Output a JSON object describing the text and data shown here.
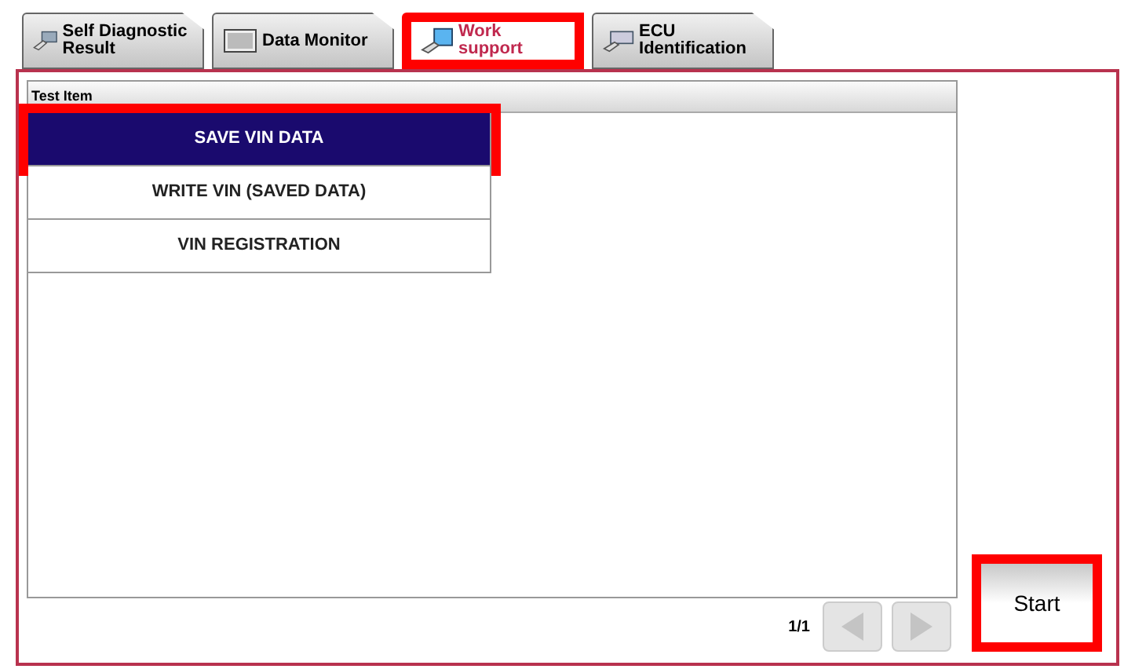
{
  "tabs": [
    {
      "label": "Self Diagnostic Result",
      "selected": false,
      "highlighted": false
    },
    {
      "label": "Data Monitor",
      "selected": false,
      "highlighted": false
    },
    {
      "label": "Work support",
      "selected": true,
      "highlighted": true
    },
    {
      "label": "ECU Identification",
      "selected": false,
      "highlighted": false
    }
  ],
  "list": {
    "header": "Test Item",
    "items": [
      {
        "label": "SAVE VIN DATA",
        "selected": true,
        "highlighted": true
      },
      {
        "label": "WRITE VIN (SAVED DATA)",
        "selected": false,
        "highlighted": false
      },
      {
        "label": "VIN REGISTRATION",
        "selected": false,
        "highlighted": false
      }
    ]
  },
  "pager": {
    "page": "1/1"
  },
  "start_button": {
    "label": "Start",
    "highlighted": true
  }
}
